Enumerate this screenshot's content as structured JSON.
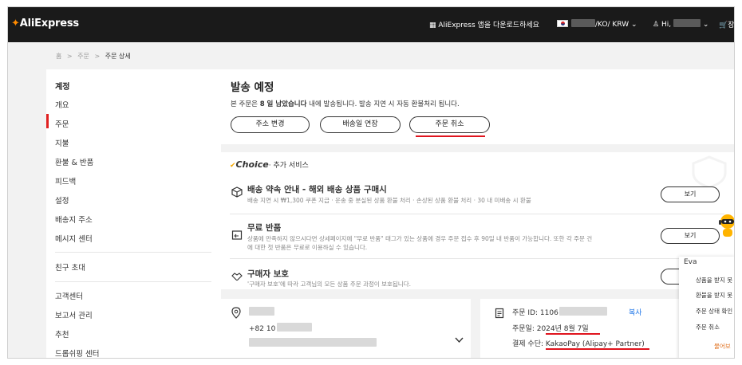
{
  "header": {
    "logo": "AliExpress",
    "app_download": "AliExpress 앱을 다운로드하세요",
    "locale": "/KO/ KRW",
    "greeting": "Hi,",
    "cart_short": "장"
  },
  "breadcrumb": {
    "home": "홈",
    "orders": "주문",
    "current": "주문 상세",
    "sep": ">"
  },
  "sidebar": {
    "title": "계정",
    "items": [
      "개요",
      "주문",
      "지불",
      "환불 & 반품",
      "피드백",
      "설정",
      "배송지 주소",
      "메시지 센터"
    ],
    "invite": "친구 초대",
    "more": [
      "고객센터",
      "보고서 관리",
      "추천",
      "드롭쉬핑 센터"
    ]
  },
  "status": {
    "title": "발송 예정",
    "desc_prefix": "본 주문은 ",
    "desc_bold": "8 일 남았습니다",
    "desc_suffix": " 내에 발송됩니다. 발송 지연 시 자동 환불처리 됩니다.",
    "buttons": [
      "주소 변경",
      "배송일 연장",
      "주문 취소"
    ]
  },
  "choice": {
    "brand": "Choice",
    "subtitle": "· 추가 서비스",
    "services": [
      {
        "title": "배송 약속 안내 - 해외 배송 상품 구매시",
        "desc": "배송 지연 시 ₩1,300 쿠폰 지급 · 운송 중 분실된 상품 환불 처리 · 손상된 상품 환불 처리 · 30 내 미배송 시 환불",
        "button": "보기"
      },
      {
        "title": "무료 반품",
        "desc": "상품에 만족하지 않으시다면 상세페이지에 \"무료 반품\" 태그가 있는 상품에 경우 주문 접수 후 90일 내 반품이 가능합니다. 또한 각 주문 건",
        "desc2": "에 대한 첫 반품은 무료로 이용하실 수 있습니다.",
        "button": "보기"
      },
      {
        "title": "구매자 보호",
        "desc": "'구매자 보호'에 따라 고객님의 모든 상품 주문 과정이 보호됩니다."
      }
    ]
  },
  "address": {
    "phone_prefix": "+82 10"
  },
  "order": {
    "id_label": "주문 ID: 1106",
    "copy": "복사",
    "date_label": "주문일: ",
    "date": "2024년 8월 7일",
    "pay_label": "결제 수단: ",
    "pay": "KakaoPay (Alipay+ Partner)"
  },
  "assistant": {
    "name": "Eva",
    "options": [
      "상품을 받지 못",
      "환불을 받지 못",
      "주문 상태 확인",
      "주문 취소"
    ],
    "ask": "물어보"
  },
  "colors": {
    "accent": "#e0141e",
    "choice_yellow": "#f5a800",
    "topbar": "#1a1a1a",
    "copy_link": "#1a73e8"
  }
}
